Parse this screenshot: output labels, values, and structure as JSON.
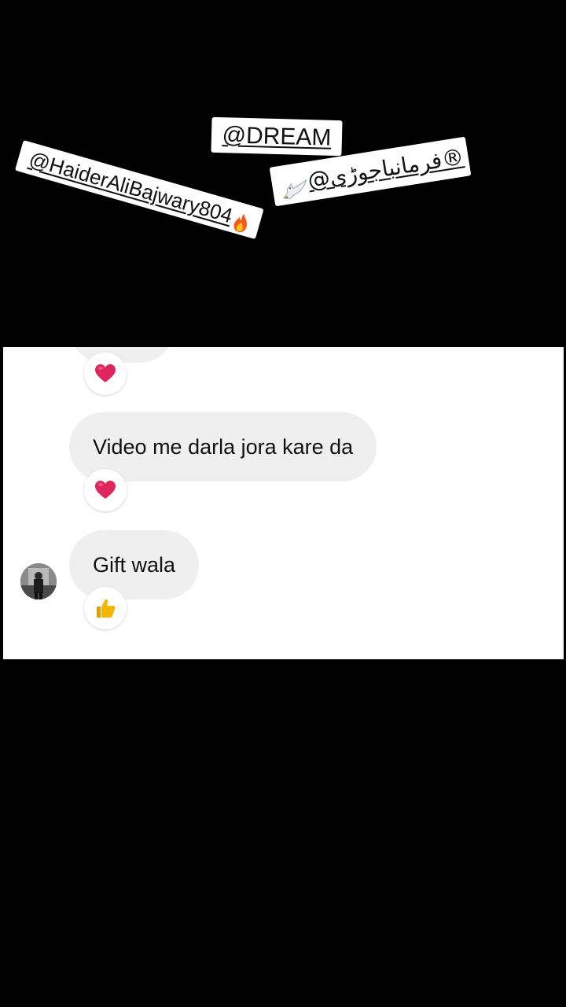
{
  "stickers": {
    "haider": "@HaiderAliBajwary804",
    "dream": "@DREAM",
    "urdu": "@فرمانباجوڑی®"
  },
  "icons": {
    "fire": "fire-icon",
    "dove": "dove-icon",
    "heart": "heart-icon",
    "thumbs_up": "thumbs-up-icon"
  },
  "colors": {
    "heart": "#e0245e",
    "thumbs_up": "#f5b700",
    "bubble_bg": "#efefef"
  },
  "chat": {
    "messages": [
      {
        "text": "Video me darla jora kare da",
        "reaction": "heart-icon"
      },
      {
        "text": "Gift wala",
        "reaction": "thumbs-up-icon"
      }
    ]
  }
}
